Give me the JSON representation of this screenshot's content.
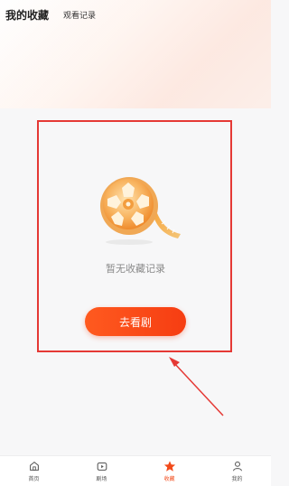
{
  "header": {
    "active_tab": "我的收藏",
    "inactive_tab": "观看记录"
  },
  "empty_state": {
    "message": "暂无收藏记录",
    "button_label": "去看剧"
  },
  "tabbar": [
    {
      "label": "首页",
      "icon": "home-icon"
    },
    {
      "label": "剧场",
      "icon": "theater-icon"
    },
    {
      "label": "收藏",
      "icon": "star-icon",
      "active": true
    },
    {
      "label": "我的",
      "icon": "profile-icon"
    }
  ],
  "colors": {
    "accent": "#f63d12",
    "annotation": "#e53935"
  }
}
